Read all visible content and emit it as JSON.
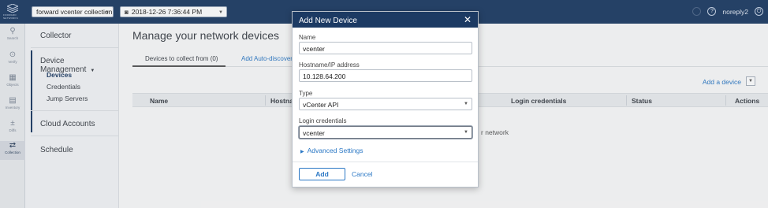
{
  "app": {
    "logo_text": "FORWARD NETWORKS"
  },
  "topbar": {
    "network_select": "forward vcenter collection",
    "snapshot_select": "2018-12-26 7:36:44 PM",
    "user": "noreply2"
  },
  "rail": {
    "items": [
      {
        "label": "Search",
        "icon": "search-icon"
      },
      {
        "label": "Verify",
        "icon": "check-circle-icon"
      },
      {
        "label": "Objects",
        "icon": "grid-icon"
      },
      {
        "label": "Inventory",
        "icon": "inventory-icon"
      },
      {
        "label": "Diffs",
        "icon": "diff-icon"
      },
      {
        "label": "Collection",
        "icon": "collection-icon"
      }
    ]
  },
  "nav": {
    "collector": "Collector",
    "device_management": "Device Management",
    "devices": "Devices",
    "credentials": "Credentials",
    "jump_servers": "Jump Servers",
    "cloud_accounts": "Cloud Accounts",
    "schedule": "Schedule"
  },
  "main": {
    "title": "Manage your network devices",
    "tab_devices": "Devices to collect from (0)",
    "tab_auto": "Add Auto-discovere",
    "add_device": "Add a device",
    "columns": {
      "name": "Name",
      "hostname": "Hostnar",
      "login_credentials": "Login credentials",
      "status": "Status",
      "actions": "Actions"
    },
    "empty_message": "r network"
  },
  "modal": {
    "title": "Add New Device",
    "name_label": "Name",
    "name_value": "vcenter",
    "host_label": "Hostname/IP address",
    "host_value": "10.128.64.200",
    "type_label": "Type",
    "type_value": "vCenter API",
    "cred_label": "Login credentials",
    "cred_value": "vcenter",
    "advanced": "Advanced Settings",
    "add_button": "Add",
    "cancel_button": "Cancel"
  },
  "colors": {
    "header": "#1c3a63",
    "link": "#2b78c5"
  }
}
